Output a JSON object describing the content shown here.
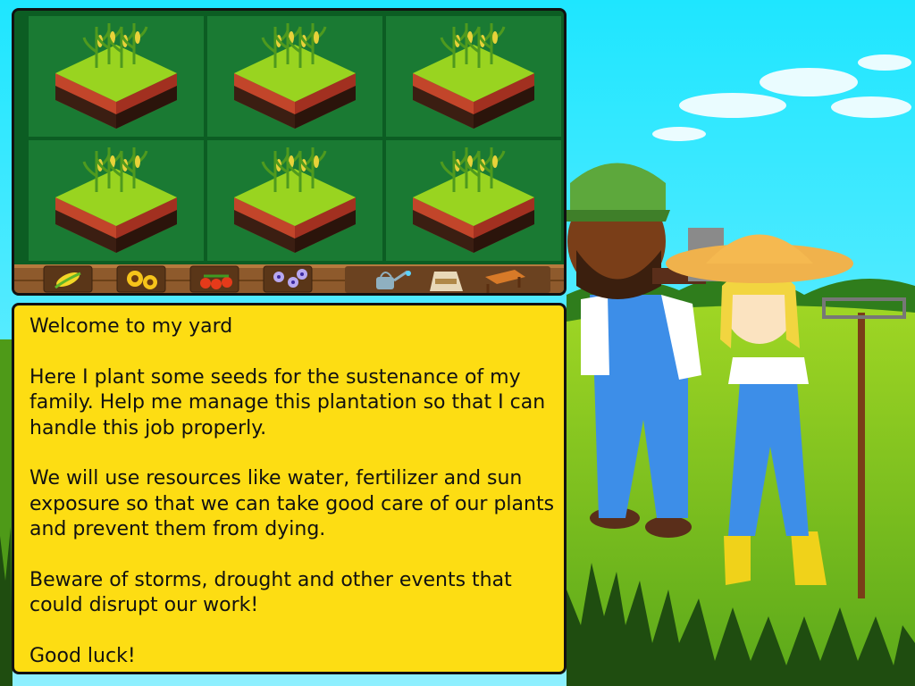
{
  "dialog": {
    "title": "Welcome to my yard",
    "paragraphs": [
      "Here I plant some seeds for the sustenance of my family. Help me manage this plantation so that I can handle this job properly.",
      "We will use resources like water, fertilizer and sun exposure so that we can take good care of our plants and prevent them from dying.",
      "Beware of storms, drought and other events that could disrupt our work!",
      "Good luck!"
    ]
  },
  "garden": {
    "plots": [
      {
        "crop": "corn"
      },
      {
        "crop": "corn"
      },
      {
        "crop": "corn"
      },
      {
        "crop": "corn"
      },
      {
        "crop": "corn"
      },
      {
        "crop": "corn"
      }
    ]
  },
  "toolbar": {
    "seeds": [
      "corn-seed-icon",
      "sunflower-seed-icon",
      "tomato-seed-icon",
      "flower-seed-icon"
    ],
    "tools": [
      "watering-can-icon",
      "fertilizer-sack-icon",
      "shade-roof-icon"
    ]
  },
  "colors": {
    "dialog_bg": "#fddd13",
    "board_bg": "#0c5d23",
    "grass": "#99d420",
    "sky": "#23e6ff"
  }
}
